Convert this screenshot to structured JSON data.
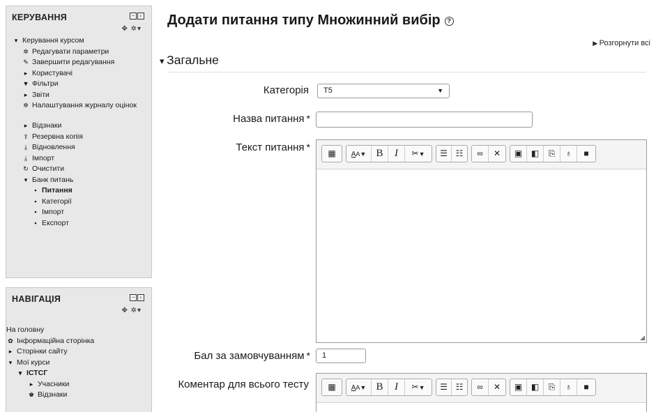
{
  "admin_block": {
    "title": "КЕРУВАННЯ",
    "items": [
      {
        "label": "Керування курсом",
        "icon": "caret-down-icon"
      },
      {
        "label": "Редагувати параметри",
        "icon": "gear-icon"
      },
      {
        "label": "Завершити редагування",
        "icon": "pencil-icon"
      },
      {
        "label": "Користувачі",
        "icon": "caret-right-icon"
      },
      {
        "label": "Фільтри",
        "icon": "filter-icon"
      },
      {
        "label": "Звіти",
        "icon": "caret-right-icon"
      },
      {
        "label": "Налаштування журналу оцінок",
        "icon": "gear-icon"
      },
      {
        "label": "Відзнаки",
        "icon": "caret-right-icon"
      },
      {
        "label": "Резервна копія",
        "icon": "upload-icon"
      },
      {
        "label": "Відновлення",
        "icon": "download-icon"
      },
      {
        "label": "Імпорт",
        "icon": "download-icon"
      },
      {
        "label": "Очистити",
        "icon": "reset-icon"
      },
      {
        "label": "Банк питань",
        "icon": "caret-down-icon"
      },
      {
        "label": "Питання",
        "icon": "bullet-icon"
      },
      {
        "label": "Категорії",
        "icon": "bullet-icon"
      },
      {
        "label": "Імпорт",
        "icon": "bullet-icon"
      },
      {
        "label": "Експорт",
        "icon": "bullet-icon"
      }
    ]
  },
  "nav_block": {
    "title": "НАВІГАЦІЯ",
    "items": [
      {
        "label": "На головну",
        "icon": ""
      },
      {
        "label": "Інформаційна сторінка",
        "icon": "dashboard-icon"
      },
      {
        "label": "Сторінки сайту",
        "icon": "caret-right-icon"
      },
      {
        "label": "Мої курси",
        "icon": "caret-down-icon"
      },
      {
        "label": "ІСТСГ",
        "icon": "caret-down-icon"
      },
      {
        "label": "Учасники",
        "icon": "caret-right-icon"
      },
      {
        "label": "Відзнаки",
        "icon": "trophy-icon"
      }
    ]
  },
  "page": {
    "title": "Додати питання типу Множинний вибір",
    "expand_all": "Розгорнути всі",
    "section": "Загальне"
  },
  "form": {
    "category_label": "Категорія",
    "category_value": "T5",
    "name_label": "Назва питання",
    "name_value": "",
    "text_label": "Текст питання",
    "default_mark_label": "Бал за замовчуванням",
    "default_mark_value": "1",
    "feedback_label": "Коментар для всього тесту",
    "required_mark": "*"
  },
  "toolbar": {
    "bold": "B",
    "italic": "I",
    "font_style": "A",
    "font_sub": "A"
  }
}
